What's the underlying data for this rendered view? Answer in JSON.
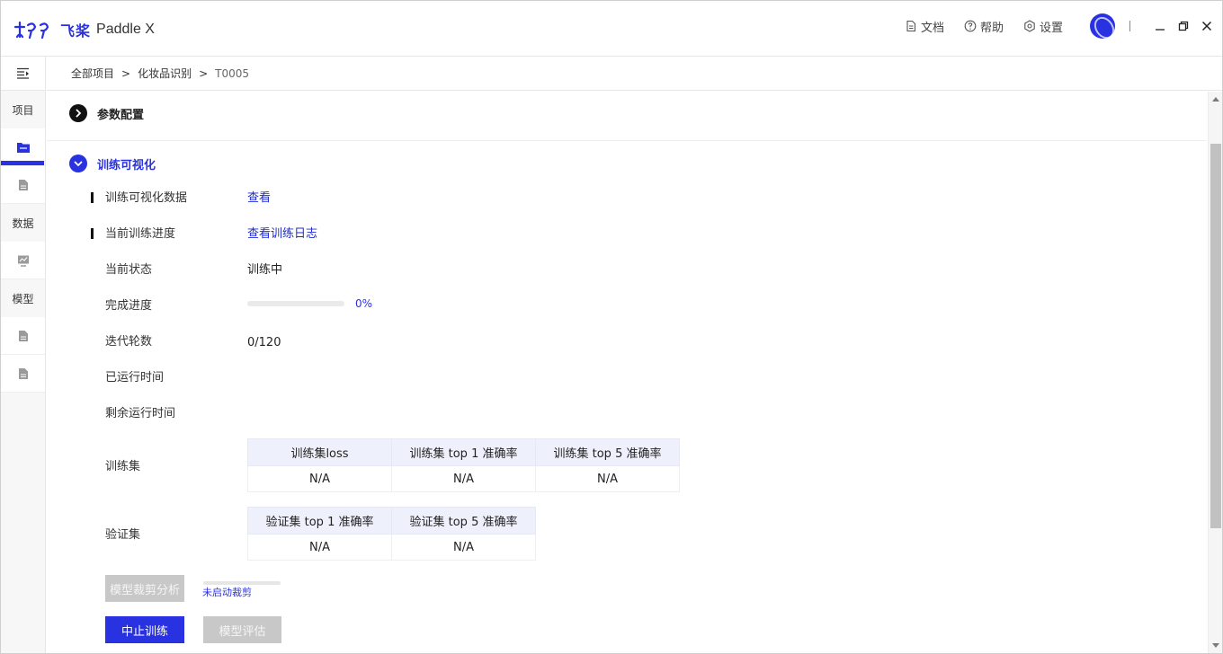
{
  "app": {
    "logo_cn": "飞桨",
    "logo_en": "Paddle X",
    "colors": {
      "accent": "#2932e1",
      "disabled": "#c8c8c8",
      "table_header": "#eef0fc"
    }
  },
  "header": {
    "docs_label": "文档",
    "help_label": "帮助",
    "settings_label": "设置",
    "icons": [
      "document-icon",
      "help-icon",
      "settings-icon",
      "avatar",
      "minimize-icon",
      "restore-icon",
      "close-icon"
    ]
  },
  "sidebar": {
    "project_label": "项目",
    "data_label": "数据",
    "model_label": "模型"
  },
  "breadcrumb": {
    "items": [
      "全部项目",
      "化妆品识别",
      "T0005"
    ],
    "sep": ">"
  },
  "params_section": {
    "title": "参数配置"
  },
  "viz_section": {
    "title": "训练可视化",
    "viz_data_label": "训练可视化数据",
    "viz_data_link": "查看",
    "progress_label": "当前训练进度",
    "progress_link": "查看训练日志",
    "status_label": "当前状态",
    "status_value": "训练中",
    "completion_label": "完成进度",
    "completion_value": "0%",
    "completion_fraction": 0,
    "epochs_label": "迭代轮数",
    "epochs_value": "0/120",
    "elapsed_label": "已运行时间",
    "remaining_label": "剩余运行时间"
  },
  "train_metrics": {
    "label": "训练集",
    "headers": [
      "训练集loss",
      "训练集 top 1 准确率",
      "训练集 top 5 准确率"
    ],
    "values": [
      "N/A",
      "N/A",
      "N/A"
    ]
  },
  "val_metrics": {
    "label": "验证集",
    "headers": [
      "验证集 top 1 准确率",
      "验证集 top 5 准确率"
    ],
    "values": [
      "N/A",
      "N/A"
    ]
  },
  "actions": {
    "prune_button": "模型裁剪分析",
    "prune_status": "未启动裁剪",
    "stop_button": "中止训练",
    "evaluate_button": "模型评估"
  }
}
